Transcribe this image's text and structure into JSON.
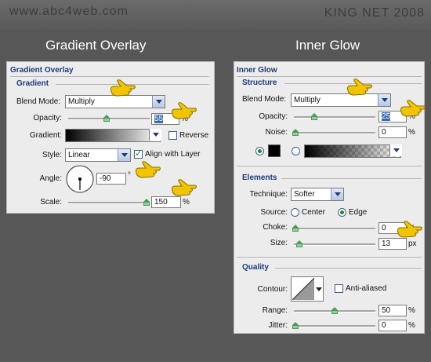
{
  "header": {
    "site": "www.abc4web.com",
    "brand": "KING NET 2008"
  },
  "left": {
    "heading": "Gradient Overlay",
    "panel_title": "Gradient Overlay",
    "section": "Gradient",
    "blend_mode": {
      "label": "Blend Mode:",
      "value": "Multiply"
    },
    "opacity": {
      "label": "Opacity:",
      "value": "55",
      "unit": "%",
      "fraction": 0.55
    },
    "gradient": {
      "label": "Gradient:",
      "reverse_label": "Reverse",
      "reverse_checked": false
    },
    "style": {
      "label": "Style:",
      "value": "Linear",
      "align_label": "Align with Layer",
      "align_checked": true
    },
    "angle": {
      "label": "Angle:",
      "value": "-90",
      "unit": "°"
    },
    "scale": {
      "label": "Scale:",
      "value": "150",
      "unit": "%",
      "fraction": 0.6
    }
  },
  "right": {
    "heading": "Inner Glow",
    "panel_title": "Inner Glow",
    "structure": {
      "section": "Structure",
      "blend_mode": {
        "label": "Blend Mode:",
        "value": "Multiply"
      },
      "opacity": {
        "label": "Opacity:",
        "value": "25",
        "unit": "%",
        "fraction": 0.25
      },
      "noise": {
        "label": "Noise:",
        "value": "0",
        "unit": "%",
        "fraction": 0
      },
      "color_swatch": "#000000"
    },
    "elements": {
      "section": "Elements",
      "technique": {
        "label": "Technique:",
        "value": "Softer"
      },
      "source": {
        "label": "Source:",
        "center_label": "Center",
        "edge_label": "Edge",
        "selected": "Edge"
      },
      "choke": {
        "label": "Choke:",
        "value": "0",
        "unit": "%",
        "fraction": 0
      },
      "size": {
        "label": "Size:",
        "value": "13",
        "unit": "px",
        "fraction": 0.05
      }
    },
    "quality": {
      "section": "Quality",
      "contour": {
        "label": "Contour:",
        "anti_aliased_label": "Anti-aliased",
        "anti_aliased_checked": false
      },
      "range": {
        "label": "Range:",
        "value": "50",
        "unit": "%",
        "fraction": 0.5
      },
      "jitter": {
        "label": "Jitter:",
        "value": "0",
        "unit": "%",
        "fraction": 0
      }
    }
  },
  "colors": {
    "accent": "#1c3a7a",
    "pointer": "#f2c400"
  }
}
